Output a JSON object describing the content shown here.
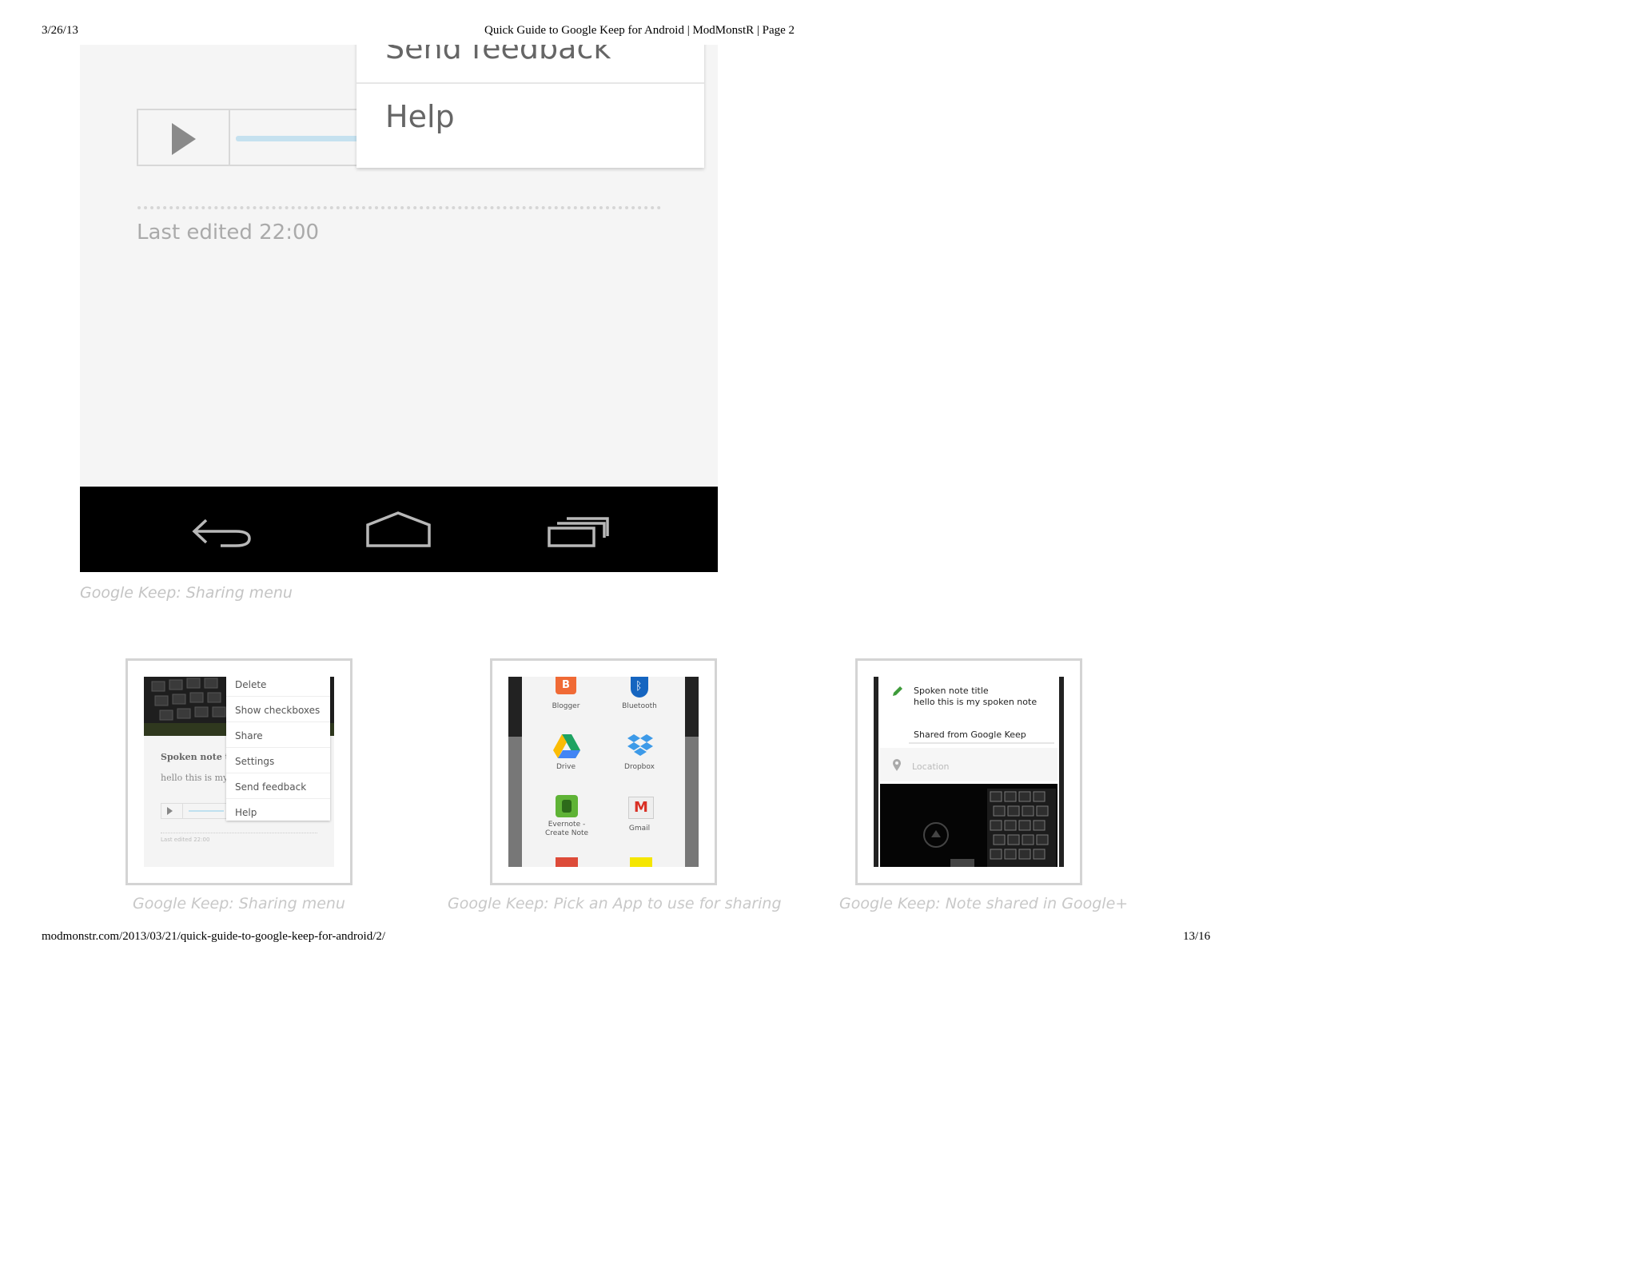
{
  "print_header": {
    "date": "3/26/13",
    "title": "Quick Guide to Google Keep for Android | ModMonstR | Page 2"
  },
  "print_footer": {
    "url": "modmonstr.com/2013/03/21/quick-guide-to-google-keep-for-android/2/",
    "page": "13/16"
  },
  "main_screenshot": {
    "menu_items": [
      "Send feedback",
      "Help"
    ],
    "last_edited": "Last edited 22:00",
    "caption": "Google Keep: Sharing menu"
  },
  "thumbnails": [
    {
      "caption": "Google Keep: Sharing menu",
      "menu_items": [
        "Delete",
        "Show checkboxes",
        "Share",
        "Settings",
        "Send feedback",
        "Help"
      ],
      "note_title": "Spoken note ti",
      "note_body": "hello this is my",
      "last_edited": "Last edited 22:00"
    },
    {
      "caption": "Google Keep: Pick an App to use for sharing",
      "apps": [
        {
          "label": "Blogger",
          "color": "#f06a35"
        },
        {
          "label": "Bluetooth",
          "color": "#1565c0"
        },
        {
          "label": "Drive",
          "color": "#1ea362"
        },
        {
          "label": "Dropbox",
          "color": "#3d9ae8"
        },
        {
          "label": "Evernote - Create Note",
          "color": "#5fb336"
        },
        {
          "label": "Gmail",
          "color": "#d93025"
        }
      ]
    },
    {
      "caption": "Google Keep: Note shared in Google+",
      "share_title": "Spoken note title",
      "share_body": "hello this is my spoken note",
      "shared_from": "Shared from Google Keep",
      "location": "Location"
    }
  ]
}
